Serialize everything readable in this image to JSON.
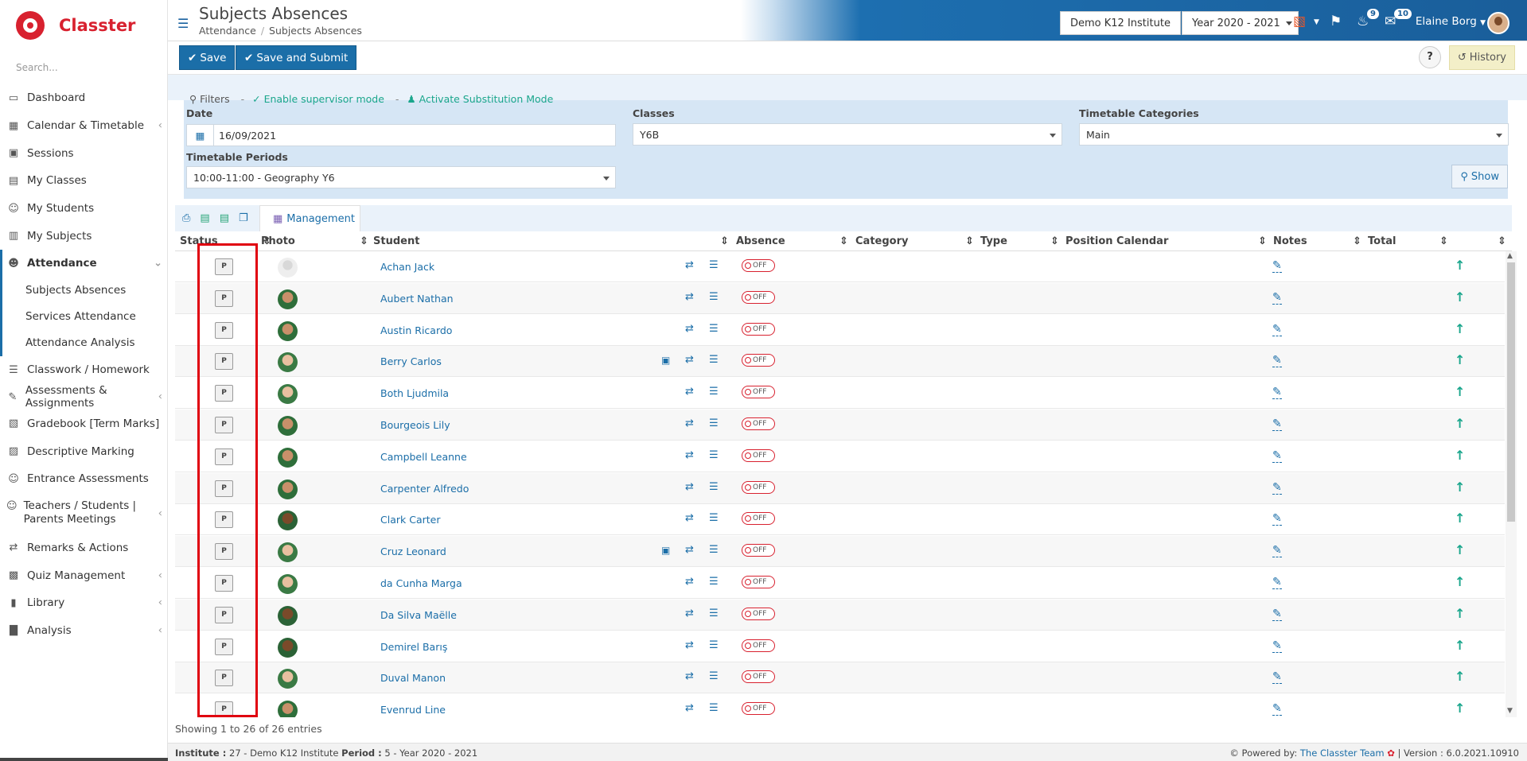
{
  "app": {
    "brand": "Classter",
    "accent": "#1b6ea8",
    "brand_color": "#d8212f"
  },
  "sidebar": {
    "search_placeholder": "Search...",
    "items": [
      {
        "label": "Dashboard",
        "icon": "laptop-icon"
      },
      {
        "label": "Calendar & Timetable",
        "icon": "calendar-icon"
      },
      {
        "label": "Sessions",
        "icon": "sessions-icon"
      },
      {
        "label": "My Classes",
        "icon": "classes-icon"
      },
      {
        "label": "My Students",
        "icon": "students-icon"
      },
      {
        "label": "My Subjects",
        "icon": "book-icon"
      },
      {
        "label": "Attendance",
        "icon": "user-check-icon"
      },
      {
        "label": "Classwork / Homework",
        "icon": "tasks-icon"
      },
      {
        "label": "Assessments & Assignments",
        "icon": "edit-icon"
      },
      {
        "label": "Gradebook [Term Marks]",
        "icon": "gradebook-icon"
      },
      {
        "label": "Descriptive Marking",
        "icon": "marking-icon"
      },
      {
        "label": "Entrance Assessments",
        "icon": "entrance-icon"
      },
      {
        "label": "Teachers / Students | Parents Meetings",
        "icon": "meetings-icon"
      },
      {
        "label": "Remarks & Actions",
        "icon": "shuffle-icon"
      },
      {
        "label": "Quiz Management",
        "icon": "quiz-icon"
      },
      {
        "label": "Library",
        "icon": "library-icon"
      },
      {
        "label": "Analysis",
        "icon": "analysis-icon"
      }
    ],
    "attendance_sub": [
      "Subjects Absences",
      "Services Attendance",
      "Attendance Analysis"
    ]
  },
  "header": {
    "title": "Subjects Absences",
    "breadcrumb": [
      "Attendance",
      "Subjects Absences"
    ],
    "institute": "Demo K12 Institute",
    "year": "Year 2020 - 2021",
    "notifications_count": "9",
    "messages_count": "10",
    "user_name": "Elaine Borg"
  },
  "toolbar": {
    "save": "Save",
    "save_submit": "Save and Submit",
    "help": "?",
    "history": "History"
  },
  "filters": {
    "title": "Filters",
    "supervisor": "Enable supervisor mode",
    "substitution": "Activate Substitution Mode",
    "date_label": "Date",
    "date_value": "16/09/2021",
    "classes_label": "Classes",
    "classes_value": "Y6B",
    "categories_label": "Timetable Categories",
    "categories_value": "Main",
    "periods_label": "Timetable Periods",
    "periods_value": "10:00-11:00 - Geography Y6",
    "show": "Show"
  },
  "table": {
    "management_tab": "Management",
    "columns": [
      "Status",
      "Photo",
      "Student",
      "Absence",
      "Category",
      "Type",
      "Position Calendar",
      "Notes",
      "Total"
    ],
    "status_label": "P",
    "absence_label": "OFF",
    "rows": [
      {
        "name": "Achan Jack",
        "bus": false,
        "photo": "blank"
      },
      {
        "name": "Aubert Nathan",
        "bus": false,
        "photo": "normal"
      },
      {
        "name": "Austin Ricardo",
        "bus": false,
        "photo": "normal"
      },
      {
        "name": "Berry Carlos",
        "bus": true,
        "photo": "light"
      },
      {
        "name": "Both Ljudmila",
        "bus": false,
        "photo": "light"
      },
      {
        "name": "Bourgeois Lily",
        "bus": false,
        "photo": "normal"
      },
      {
        "name": "Campbell Leanne",
        "bus": false,
        "photo": "normal"
      },
      {
        "name": "Carpenter Alfredo",
        "bus": false,
        "photo": "normal"
      },
      {
        "name": "Clark Carter",
        "bus": false,
        "photo": "dark"
      },
      {
        "name": "Cruz Leonard",
        "bus": true,
        "photo": "light"
      },
      {
        "name": "da Cunha Marga",
        "bus": false,
        "photo": "light"
      },
      {
        "name": "Da Silva Maëlle",
        "bus": false,
        "photo": "dark"
      },
      {
        "name": "Demirel Barış",
        "bus": false,
        "photo": "dark"
      },
      {
        "name": "Duval Manon",
        "bus": false,
        "photo": "light"
      },
      {
        "name": "Evenrud Line",
        "bus": false,
        "photo": "normal"
      }
    ],
    "showing": "Showing 1 to 26 of 26 entries"
  },
  "footer": {
    "institute_label": "Institute :",
    "institute_value": " 27 - Demo K12 Institute ",
    "period_label": "Period :",
    "period_value": " 5 - Year 2020 - 2021",
    "powered_by": "Powered by:",
    "team": "The Classter Team",
    "version": "| Version : 6.0.2021.10910"
  }
}
